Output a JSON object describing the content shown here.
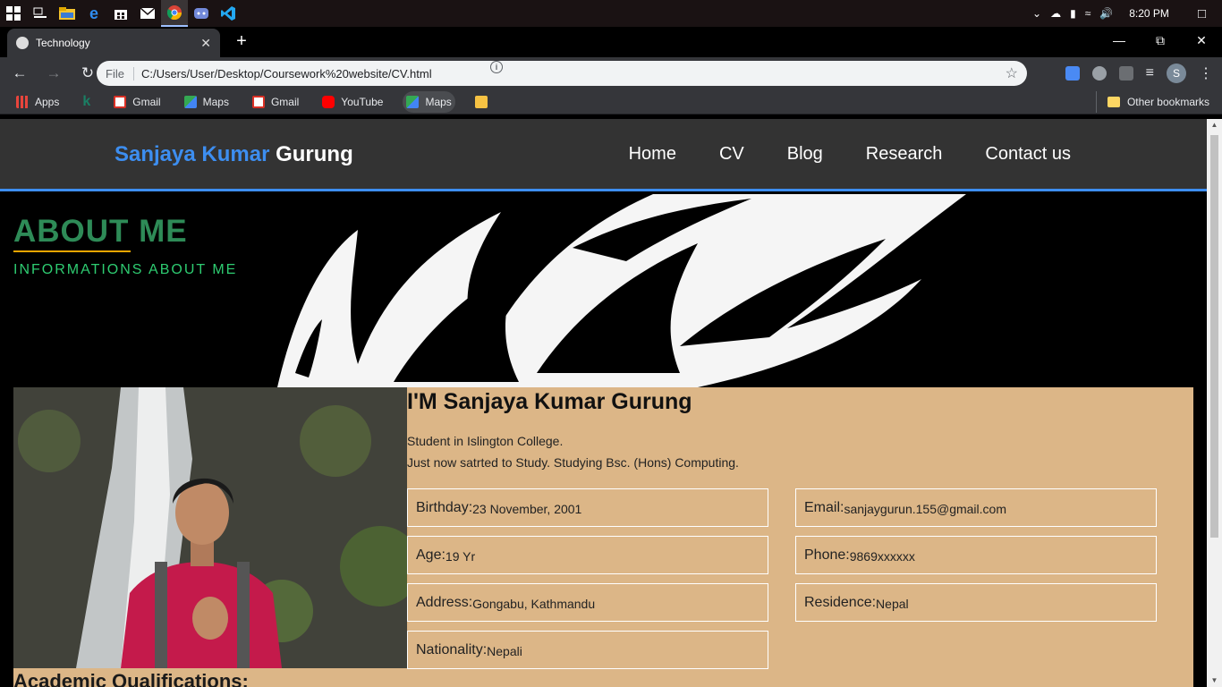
{
  "taskbar": {
    "time": "8:20 PM"
  },
  "browser": {
    "tab_title": "Technology",
    "url_scheme": "File",
    "url": "C:/Users/User/Desktop/Coursework%20website/CV.html",
    "profile_initial": "S"
  },
  "bookmarks": [
    {
      "label": "Apps",
      "color": "#e8453c"
    },
    {
      "label": "",
      "color": "#1a7f64"
    },
    {
      "label": "Gmail",
      "color": "#d93025"
    },
    {
      "label": "Maps",
      "color": "#34a853"
    },
    {
      "label": "Gmail",
      "color": "#d93025"
    },
    {
      "label": "YouTube",
      "color": "#ff0000"
    },
    {
      "label": "Maps",
      "color": "#34a853"
    },
    {
      "label": "",
      "color": "#f6c243"
    }
  ],
  "other_bookmarks": "Other bookmarks",
  "site": {
    "brand_first": "Sanjaya Kumar",
    "brand_last": "Gurung",
    "nav": [
      "Home",
      "CV",
      "Blog",
      "Research",
      "Contact us"
    ],
    "accent_color": "#3d8ef0"
  },
  "about": {
    "title": "ABOUT ME",
    "subtitle": "INFORMATIONS ABOUT ME"
  },
  "profile": {
    "heading": "I'M Sanjaya Kumar Gurung",
    "desc_line1": "Student in Islington College.",
    "desc_line2": "Just now satrted to Study. Studying Bsc. (Hons) Computing.",
    "fields": {
      "birthday": {
        "label": "Birthday:",
        "value": "23 November, 2001"
      },
      "email": {
        "label": "Email:",
        "value": "sanjaygurun.155@gmail.com"
      },
      "age": {
        "label": "Age:",
        "value": "19 Yr"
      },
      "phone": {
        "label": "Phone:",
        "value": "9869xxxxxx"
      },
      "address": {
        "label": "Address:",
        "value": "Gongabu, Kathmandu"
      },
      "residence": {
        "label": "Residence:",
        "value": "Nepal"
      },
      "nationality": {
        "label": "Nationality:",
        "value": "Nepali"
      }
    },
    "academic_heading": "Academic Qualifications:"
  }
}
